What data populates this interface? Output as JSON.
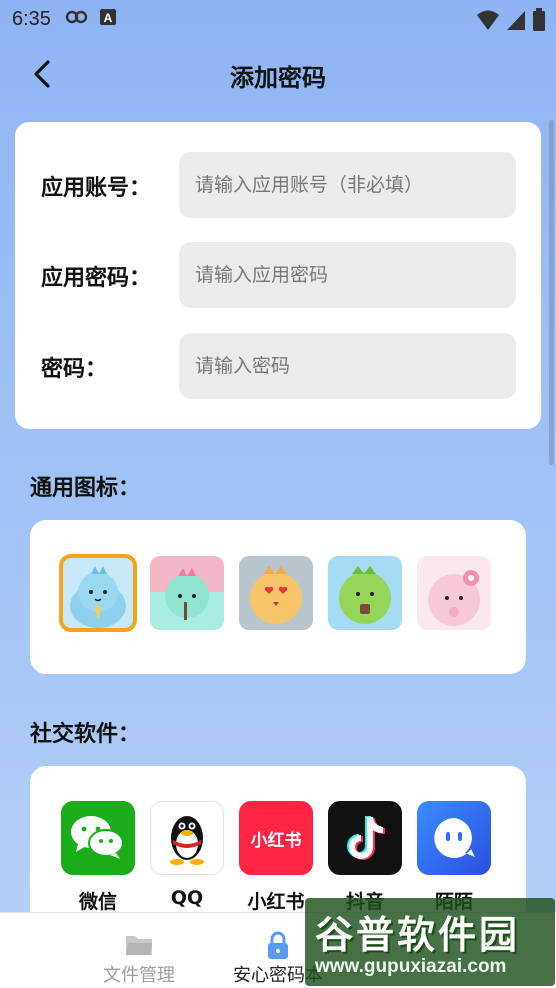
{
  "status_bar": {
    "time": "6:35",
    "left_icons": [
      "assistant-icon",
      "a-notification-icon"
    ],
    "right_icons": [
      "wifi-icon",
      "signal-icon",
      "battery-icon"
    ]
  },
  "header": {
    "back_icon": "chevron-left-icon",
    "title": "添加密码"
  },
  "form": {
    "app_account": {
      "label": "应用账号：",
      "placeholder": "请输入应用账号（非必填）",
      "value": ""
    },
    "app_password": {
      "label": "应用密码：",
      "placeholder": "请输入应用密码",
      "value": ""
    },
    "password": {
      "label": "密码：",
      "placeholder": "请输入密码",
      "value": ""
    }
  },
  "general_icons": {
    "title": "通用图标：",
    "items": [
      {
        "name": "dino-blue",
        "color": "#bfe6f5",
        "selected": true
      },
      {
        "name": "dino-mint",
        "color": "#f3b7c6",
        "selected": false
      },
      {
        "name": "dino-orange",
        "color": "#b8c4cc",
        "selected": false
      },
      {
        "name": "dino-green",
        "color": "#9fd7f2",
        "selected": false
      },
      {
        "name": "dino-pink",
        "color": "#fbe6ec",
        "selected": false
      }
    ],
    "selected_color": "#f4a31b"
  },
  "social_apps": {
    "title": "社交软件：",
    "items": [
      {
        "label": "微信",
        "icon": "wechat-icon",
        "color": "#1aad19"
      },
      {
        "label": "QQ",
        "icon": "qq-penguin-icon",
        "color": "#ffffff"
      },
      {
        "label": "小红书",
        "icon": "xiaohongshu-icon",
        "color": "#ff2442",
        "icon_text": "小红书"
      },
      {
        "label": "抖音",
        "icon": "douyin-icon",
        "color": "#111111"
      },
      {
        "label": "陌陌",
        "icon": "momo-icon",
        "color": "#2e6cf6"
      }
    ]
  },
  "tabbar": {
    "tabs": [
      {
        "label": "文件管理",
        "icon": "folder-icon",
        "active": false
      },
      {
        "label": "安心密码本",
        "icon": "lock-icon",
        "active": true
      }
    ],
    "active_color": "#5b9cf2",
    "inactive_color": "#c8c8c8"
  },
  "watermark": {
    "main": "谷普软件园",
    "sub": "www.gupuxiazai.com"
  }
}
